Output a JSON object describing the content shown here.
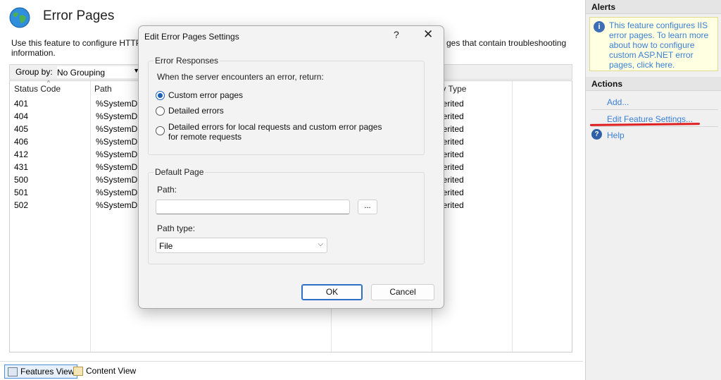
{
  "page": {
    "title": "Error Pages",
    "description": "Use this feature to configure HTTP e … ges that contain troubleshooting information.",
    "description_left": "Use this feature to configure HTTP e",
    "description_right": "ges that contain troubleshooting",
    "description_line2": "information."
  },
  "groupby": {
    "label": "Group by:",
    "value": "No Grouping"
  },
  "table": {
    "columns": [
      "Status Code",
      "Path",
      "Entry Type"
    ],
    "entry_type_visible": "try Type",
    "rows": [
      {
        "code": "401",
        "path": "%SystemDriv",
        "type": "herited"
      },
      {
        "code": "404",
        "path": "%SystemDriv",
        "type": "herited"
      },
      {
        "code": "405",
        "path": "%SystemDriv",
        "type": "herited"
      },
      {
        "code": "406",
        "path": "%SystemDriv",
        "type": "herited"
      },
      {
        "code": "412",
        "path": "%SystemDriv",
        "type": "herited"
      },
      {
        "code": "431",
        "path": "%SystemDriv",
        "type": "herited"
      },
      {
        "code": "500",
        "path": "%SystemDriv",
        "type": "herited"
      },
      {
        "code": "501",
        "path": "%SystemDriv",
        "type": "herited"
      },
      {
        "code": "502",
        "path": "%SystemDriv",
        "type": "herited"
      }
    ]
  },
  "views": {
    "features": "Features View",
    "content": "Content View"
  },
  "alerts": {
    "header": "Alerts",
    "text": "This feature configures IIS error pages. To learn more about how to configure custom ASP.NET error pages, click here."
  },
  "actions": {
    "header": "Actions",
    "add": "Add...",
    "edit": "Edit Feature Settings...",
    "help": "Help"
  },
  "dialog": {
    "title": "Edit Error Pages Settings",
    "help_glyph": "?",
    "close_glyph": "✕",
    "error_responses": {
      "legend": "Error Responses",
      "prompt": "When the server encounters an error, return:",
      "options": [
        "Custom error pages",
        "Detailed errors",
        "Detailed errors for local requests and custom error pages for remote requests"
      ],
      "option3_line1": "Detailed errors for local requests and custom error pages",
      "option3_line2": "for remote requests",
      "selected_index": 0
    },
    "default_page": {
      "legend": "Default Page",
      "path_label": "Path:",
      "path_value": "",
      "browse_label": "...",
      "path_type_label": "Path type:",
      "path_type_value": "File"
    },
    "ok_label": "OK",
    "cancel_label": "Cancel"
  },
  "colors": {
    "link": "#3a7fd5",
    "accent": "#1a5fb4",
    "highlight": "#e02020",
    "alert_bg": "#ffffe1"
  }
}
